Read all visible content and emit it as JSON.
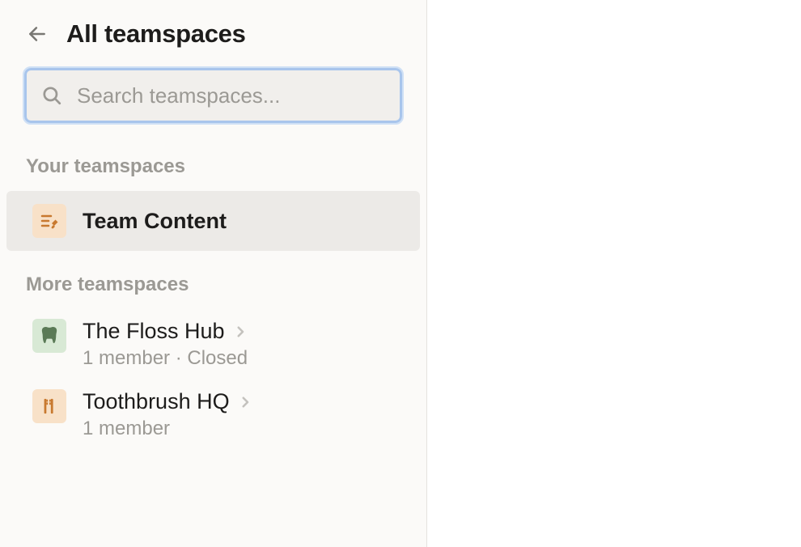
{
  "header": {
    "title": "All teamspaces"
  },
  "search": {
    "placeholder": "Search teamspaces..."
  },
  "sections": {
    "yours": {
      "title": "Your teamspaces",
      "items": [
        {
          "name": "Team Content",
          "icon_bg": "orange",
          "icon": "edit-note"
        }
      ]
    },
    "more": {
      "title": "More teamspaces",
      "items": [
        {
          "name": "The Floss Hub",
          "meta": "1 member · Closed",
          "icon_bg": "green",
          "icon": "tooth"
        },
        {
          "name": "Toothbrush HQ",
          "meta": "1 member",
          "icon_bg": "orange",
          "icon": "toothbrush"
        }
      ]
    }
  }
}
